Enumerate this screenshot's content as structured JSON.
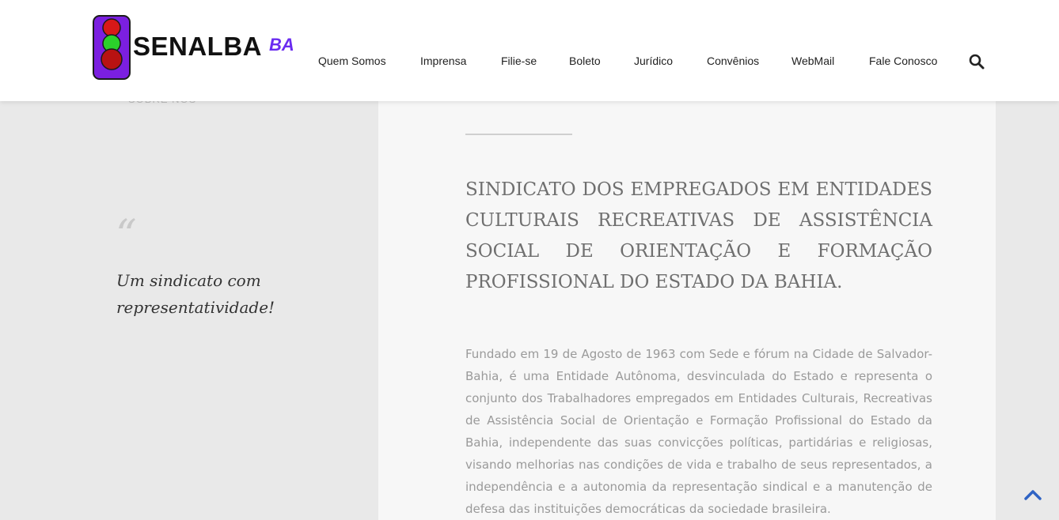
{
  "header": {
    "logo_text": "SENALBA",
    "logo_suffix": "BA",
    "nav": [
      {
        "label": "Quem Somos"
      },
      {
        "label": "Imprensa"
      },
      {
        "label": "Filie-se"
      },
      {
        "label": "Boleto"
      },
      {
        "label": "Jurídico"
      },
      {
        "label": "Convênios"
      },
      {
        "label": "WebMail"
      },
      {
        "label": "Fale Conosco"
      }
    ],
    "search_icon": "search-icon"
  },
  "sidebar": {
    "section_label": "SOBRE NÓS",
    "quote_glyph": "“",
    "tagline": "Um sindicato com representatividade!"
  },
  "main": {
    "headline": "SINDICATO DOS EMPREGADOS EM ENTIDADES CULTURAIS RECREATIVAS DE ASSISTÊNCIA SOCIAL DE ORIENTAÇÃO E FORMAÇÃO PROFISSIONAL DO ESTADO DA BAHIA.",
    "body": "Fundado em 19 de Agosto de 1963 com Sede e fórum na Cidade de Salvador-Bahia, é uma Entidade Autônoma, desvinculada do Estado e representa o conjunto dos Trabalhadores empregados em Entidades Culturais, Recreativas de Assistência Social de Orientação e Formação Profissional do Estado da Bahia, independente das suas convicções políticas, partidárias e religiosas, visando melhorias nas condições de vida e trabalho de seus representados, a independência e a autonomia da representação sindical e a manutenção de defesa das instituições democráticas da sociedade brasileira."
  },
  "colors": {
    "logo_purple": "#7b1fe0",
    "accent_ba": "#6a2cf0",
    "back_to_top": "#2f63c4"
  }
}
